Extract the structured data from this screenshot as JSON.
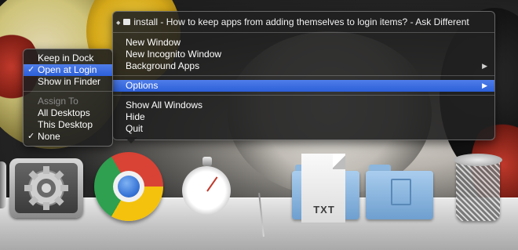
{
  "window_title": "install - How to keep apps from adding themselves to login items? - Ask Different",
  "main_menu": {
    "items_group1": [
      {
        "label": "New Window"
      },
      {
        "label": "New Incognito Window"
      },
      {
        "label": "Background Apps",
        "submenu": true
      }
    ],
    "options": {
      "label": "Options",
      "submenu": true,
      "highlighted": true
    },
    "items_group3": [
      {
        "label": "Show All Windows"
      },
      {
        "label": "Hide"
      },
      {
        "label": "Quit"
      }
    ]
  },
  "options_submenu": {
    "keep_in_dock": "Keep in Dock",
    "open_at_login": "Open at Login",
    "open_at_login_checked": true,
    "show_in_finder": "Show in Finder",
    "assign_to_header": "Assign To",
    "all_desktops": "All Desktops",
    "this_desktop": "This Desktop",
    "none": "None",
    "none_checked": true
  },
  "check_mark": "✓",
  "submenu_arrow": "▶",
  "diamond_glyph": "◆",
  "dock": {
    "icons": [
      {
        "name": "System Preferences",
        "icon": "gear-icon"
      },
      {
        "name": "Google Chrome",
        "icon": "chrome-icon"
      },
      {
        "name": "Stopwatch",
        "icon": "stopwatch-icon"
      },
      {
        "name": "Text Document",
        "icon": "txt-document-icon",
        "label": "TXT"
      },
      {
        "name": "Folder",
        "icon": "folder-icon"
      },
      {
        "name": "Documents Folder",
        "icon": "documents-folder-icon"
      },
      {
        "name": "Trash",
        "icon": "trash-icon"
      }
    ],
    "txt_label": "TXT"
  },
  "colors": {
    "highlight": "#2c5fd8",
    "menu_bg": "#202020"
  }
}
